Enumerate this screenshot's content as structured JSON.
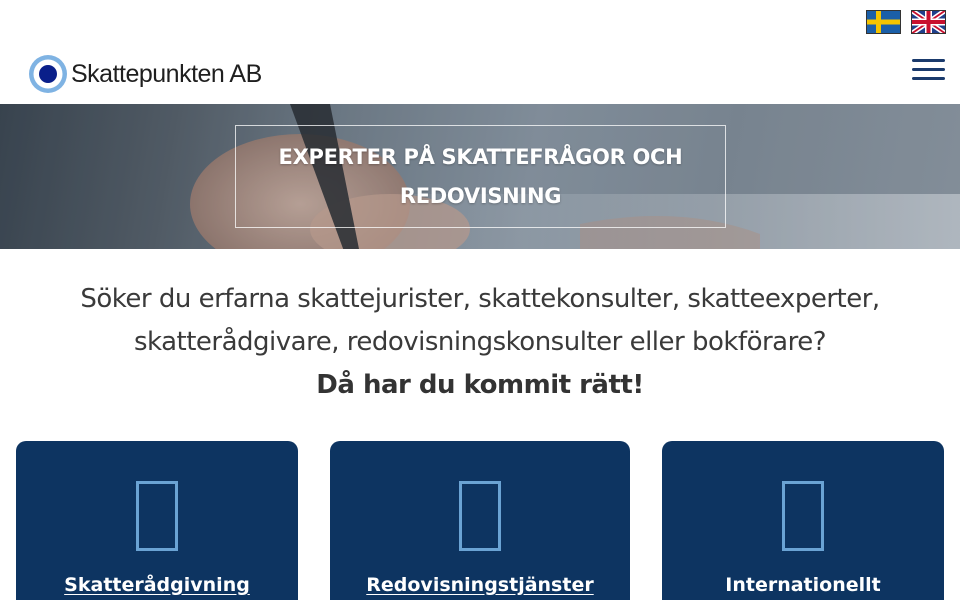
{
  "header": {
    "logo_text": "Skattepunkten AB",
    "logo_icon": "target-circle-logo",
    "flags": [
      {
        "name": "swedish-flag-icon",
        "lang": "sv"
      },
      {
        "name": "uk-flag-icon",
        "lang": "en"
      }
    ],
    "menu_icon": "hamburger-menu-icon",
    "accent_color": "#1a3a6c"
  },
  "hero": {
    "title_line1": "EXPERTER PÅ SKATTEFRÅGOR OCH",
    "title_line2": "REDOVISNING"
  },
  "intro": {
    "line1": "Söker du erfarna skattejurister, skattekonsulter, skatteexperter,",
    "line2": "skatterådgivare, redovisningskonsulter eller bokförare?",
    "strong": "Då har du kommit rätt!"
  },
  "cards": [
    {
      "title": "Skatterådgivning",
      "icon": "missing-glyph-icon",
      "link": true
    },
    {
      "title": "Redovisningstjänster",
      "icon": "missing-glyph-icon",
      "link": true
    },
    {
      "title": "Internationellt",
      "icon": "missing-glyph-icon",
      "link": false
    }
  ],
  "colors": {
    "card_bg": "#0d3461",
    "icon_outline": "#6aa3d4"
  }
}
